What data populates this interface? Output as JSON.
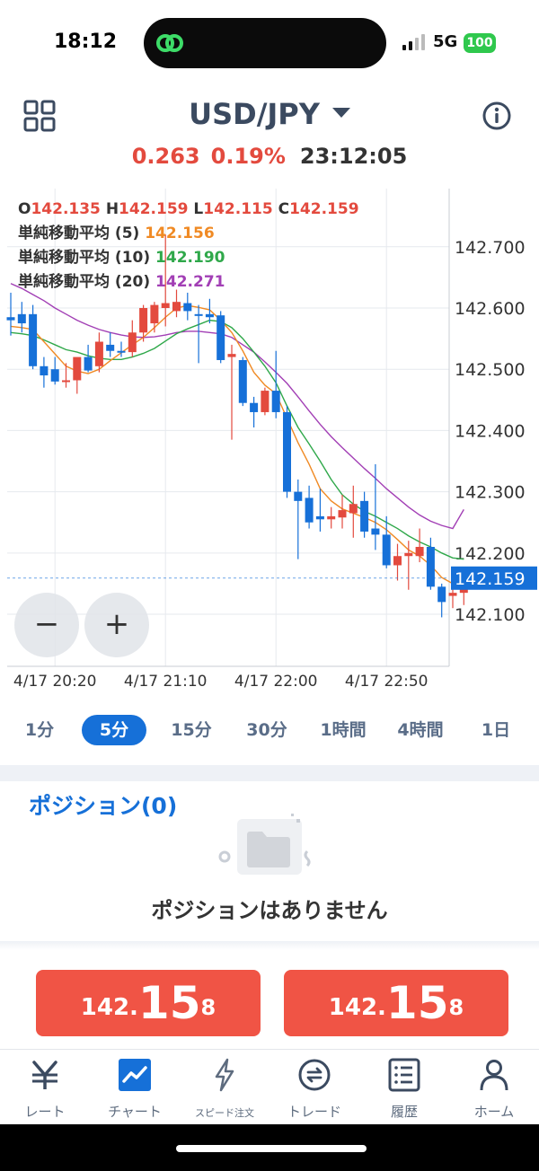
{
  "status_bar": {
    "time": "18:12",
    "network": "5G",
    "battery": "100"
  },
  "header": {
    "pair": "USD/JPY",
    "change": "0.263",
    "change_pct": "0.19%",
    "server_time": "23:12:05",
    "up_color": "#e34a3e",
    "down_color": "#1670d8"
  },
  "chart_data": {
    "type": "candlestick",
    "ohlc_readout": {
      "o_label": "O",
      "o": "142.135",
      "h_label": "H",
      "h": "142.159",
      "l_label": "L",
      "l": "142.115",
      "c_label": "C",
      "c": "142.159"
    },
    "indicators": [
      {
        "label": "単純移動平均 (5)",
        "value": "142.156",
        "color": "#f08a24"
      },
      {
        "label": "単純移動平均 (10)",
        "value": "142.190",
        "color": "#2fa84a"
      },
      {
        "label": "単純移動平均 (20)",
        "value": "142.271",
        "color": "#a23fb5"
      }
    ],
    "y_ticks": [
      "142.700",
      "142.600",
      "142.500",
      "142.400",
      "142.300",
      "142.200",
      "142.100"
    ],
    "y_tick_values": [
      142.7,
      142.6,
      142.5,
      142.4,
      142.3,
      142.2,
      142.1
    ],
    "ylim": [
      142.015,
      142.795
    ],
    "x_ticks": [
      "4/17 20:20",
      "4/17 21:10",
      "4/17 22:00",
      "4/17 22:50"
    ],
    "x_tick_index": [
      4,
      14,
      24,
      34
    ],
    "current_price_label": "142.159",
    "current_price": 142.159,
    "candles": [
      {
        "o": 142.585,
        "h": 142.625,
        "l": 142.555,
        "c": 142.58
      },
      {
        "o": 142.59,
        "h": 142.61,
        "l": 142.56,
        "c": 142.575
      },
      {
        "o": 142.59,
        "h": 142.605,
        "l": 142.5,
        "c": 142.505
      },
      {
        "o": 142.505,
        "h": 142.52,
        "l": 142.47,
        "c": 142.49
      },
      {
        "o": 142.5,
        "h": 142.52,
        "l": 142.475,
        "c": 142.48
      },
      {
        "o": 142.48,
        "h": 142.51,
        "l": 142.47,
        "c": 142.482
      },
      {
        "o": 142.482,
        "h": 142.49,
        "l": 142.46,
        "c": 142.52
      },
      {
        "o": 142.52,
        "h": 142.54,
        "l": 142.495,
        "c": 142.498
      },
      {
        "o": 142.505,
        "h": 142.56,
        "l": 142.495,
        "c": 142.545
      },
      {
        "o": 142.54,
        "h": 142.56,
        "l": 142.52,
        "c": 142.53
      },
      {
        "o": 142.53,
        "h": 142.545,
        "l": 142.52,
        "c": 142.528
      },
      {
        "o": 142.528,
        "h": 142.58,
        "l": 142.52,
        "c": 142.56
      },
      {
        "o": 142.56,
        "h": 142.605,
        "l": 142.545,
        "c": 142.6
      },
      {
        "o": 142.575,
        "h": 142.61,
        "l": 142.56,
        "c": 142.605
      },
      {
        "o": 142.6,
        "h": 142.72,
        "l": 142.57,
        "c": 142.608
      },
      {
        "o": 142.595,
        "h": 142.63,
        "l": 142.585,
        "c": 142.61
      },
      {
        "o": 142.608,
        "h": 142.625,
        "l": 142.58,
        "c": 142.595
      },
      {
        "o": 142.59,
        "h": 142.605,
        "l": 142.51,
        "c": 142.588
      },
      {
        "o": 142.59,
        "h": 142.615,
        "l": 142.575,
        "c": 142.585
      },
      {
        "o": 142.588,
        "h": 142.595,
        "l": 142.51,
        "c": 142.515
      },
      {
        "o": 142.52,
        "h": 142.54,
        "l": 142.385,
        "c": 142.525
      },
      {
        "o": 142.515,
        "h": 142.52,
        "l": 142.44,
        "c": 142.445
      },
      {
        "o": 142.445,
        "h": 142.455,
        "l": 142.405,
        "c": 142.43
      },
      {
        "o": 142.43,
        "h": 142.47,
        "l": 142.425,
        "c": 142.465
      },
      {
        "o": 142.465,
        "h": 142.53,
        "l": 142.42,
        "c": 142.43
      },
      {
        "o": 142.43,
        "h": 142.44,
        "l": 142.29,
        "c": 142.3
      },
      {
        "o": 142.3,
        "h": 142.32,
        "l": 142.19,
        "c": 142.285
      },
      {
        "o": 142.29,
        "h": 142.31,
        "l": 142.24,
        "c": 142.25
      },
      {
        "o": 142.26,
        "h": 142.305,
        "l": 142.235,
        "c": 142.255
      },
      {
        "o": 142.255,
        "h": 142.275,
        "l": 142.24,
        "c": 142.26
      },
      {
        "o": 142.258,
        "h": 142.295,
        "l": 142.24,
        "c": 142.27
      },
      {
        "o": 142.265,
        "h": 142.31,
        "l": 142.225,
        "c": 142.28
      },
      {
        "o": 142.285,
        "h": 142.3,
        "l": 142.225,
        "c": 142.235
      },
      {
        "o": 142.24,
        "h": 142.345,
        "l": 142.205,
        "c": 142.23
      },
      {
        "o": 142.23,
        "h": 142.26,
        "l": 142.175,
        "c": 142.18
      },
      {
        "o": 142.18,
        "h": 142.215,
        "l": 142.155,
        "c": 142.195
      },
      {
        "o": 142.195,
        "h": 142.22,
        "l": 142.14,
        "c": 142.2
      },
      {
        "o": 142.195,
        "h": 142.24,
        "l": 142.185,
        "c": 142.21
      },
      {
        "o": 142.21,
        "h": 142.225,
        "l": 142.14,
        "c": 142.145
      },
      {
        "o": 142.145,
        "h": 142.15,
        "l": 142.095,
        "c": 142.12
      },
      {
        "o": 142.13,
        "h": 142.15,
        "l": 142.11,
        "c": 142.135
      },
      {
        "o": 142.135,
        "h": 142.159,
        "l": 142.115,
        "c": 142.159
      }
    ],
    "ma5": [
      142.57,
      142.568,
      142.565,
      142.545,
      142.525,
      142.505,
      142.497,
      142.493,
      142.5,
      142.514,
      142.527,
      142.54,
      142.552,
      142.568,
      142.585,
      142.6,
      142.604,
      142.601,
      142.597,
      142.58,
      142.56,
      142.53,
      142.495,
      142.474,
      142.46,
      142.42,
      142.38,
      142.345,
      142.305,
      142.285,
      142.272,
      142.265,
      142.258,
      142.25,
      142.238,
      142.222,
      142.205,
      142.195,
      142.18,
      142.16,
      142.15,
      142.15
    ],
    "ma10": [
      142.56,
      142.558,
      142.555,
      142.548,
      142.54,
      142.532,
      142.528,
      142.522,
      142.518,
      142.516,
      142.516,
      142.52,
      142.526,
      142.534,
      142.546,
      142.558,
      142.566,
      142.573,
      142.58,
      142.578,
      142.568,
      142.55,
      142.528,
      142.505,
      142.478,
      142.44,
      142.405,
      142.378,
      142.35,
      142.32,
      142.295,
      142.28,
      142.268,
      142.26,
      142.25,
      142.24,
      142.228,
      142.218,
      142.21,
      142.2,
      142.192,
      142.19
    ],
    "ma20": [
      142.64,
      142.632,
      142.622,
      142.612,
      142.6,
      142.59,
      142.58,
      142.572,
      142.565,
      142.56,
      142.556,
      142.553,
      142.552,
      142.553,
      142.556,
      142.56,
      142.562,
      142.562,
      142.56,
      142.558,
      142.552,
      142.54,
      142.528,
      142.512,
      142.495,
      142.477,
      142.455,
      142.432,
      142.41,
      142.39,
      142.372,
      142.355,
      142.338,
      142.322,
      142.305,
      142.29,
      142.275,
      142.262,
      142.252,
      142.245,
      142.24,
      142.271
    ]
  },
  "zoom": {
    "minus": "−",
    "plus": "+"
  },
  "timeframes": [
    {
      "label": "1分",
      "active": false
    },
    {
      "label": "5分",
      "active": true
    },
    {
      "label": "15分",
      "active": false
    },
    {
      "label": "30分",
      "active": false
    },
    {
      "label": "1時間",
      "active": false
    },
    {
      "label": "4時間",
      "active": false
    },
    {
      "label": "1日",
      "active": false
    }
  ],
  "positions": {
    "title": "ポジション(0)",
    "empty_text": "ポジションはありません"
  },
  "trade": {
    "sell": {
      "p1": "142.",
      "p2": "15",
      "p3": "8"
    },
    "buy": {
      "p1": "142.",
      "p2": "15",
      "p3": "8"
    }
  },
  "tabs": [
    {
      "label": "レート",
      "icon": "yen-icon"
    },
    {
      "label": "チャート",
      "icon": "chart-icon"
    },
    {
      "label": "スピード注文",
      "icon": "lightning-icon"
    },
    {
      "label": "トレード",
      "icon": "exchange-icon"
    },
    {
      "label": "履歴",
      "icon": "list-icon"
    },
    {
      "label": "ホーム",
      "icon": "user-icon"
    }
  ]
}
